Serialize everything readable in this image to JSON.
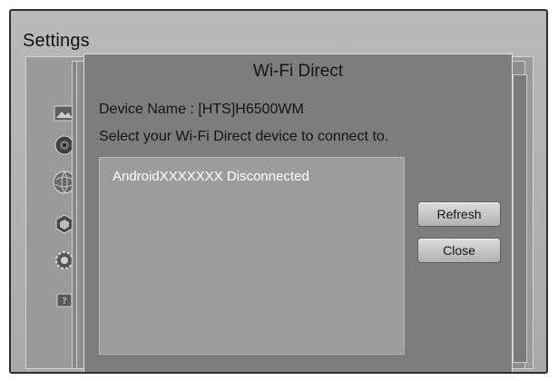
{
  "screen": {
    "title": "Settings"
  },
  "sidebar": {
    "icons": [
      {
        "name": "picture-icon"
      },
      {
        "name": "sound-icon"
      },
      {
        "name": "network-icon"
      },
      {
        "name": "smart-features-icon"
      },
      {
        "name": "system-icon"
      },
      {
        "name": "support-icon"
      }
    ]
  },
  "dialog": {
    "title": "Wi-Fi Direct",
    "device_name": "Device Name : [HTS]H6500WM",
    "prompt": "Select your Wi-Fi Direct device to connect to.",
    "devices": [
      {
        "label": "AndroidXXXXXXX Disconnected"
      }
    ],
    "buttons": {
      "refresh": "Refresh",
      "close": "Close"
    }
  }
}
